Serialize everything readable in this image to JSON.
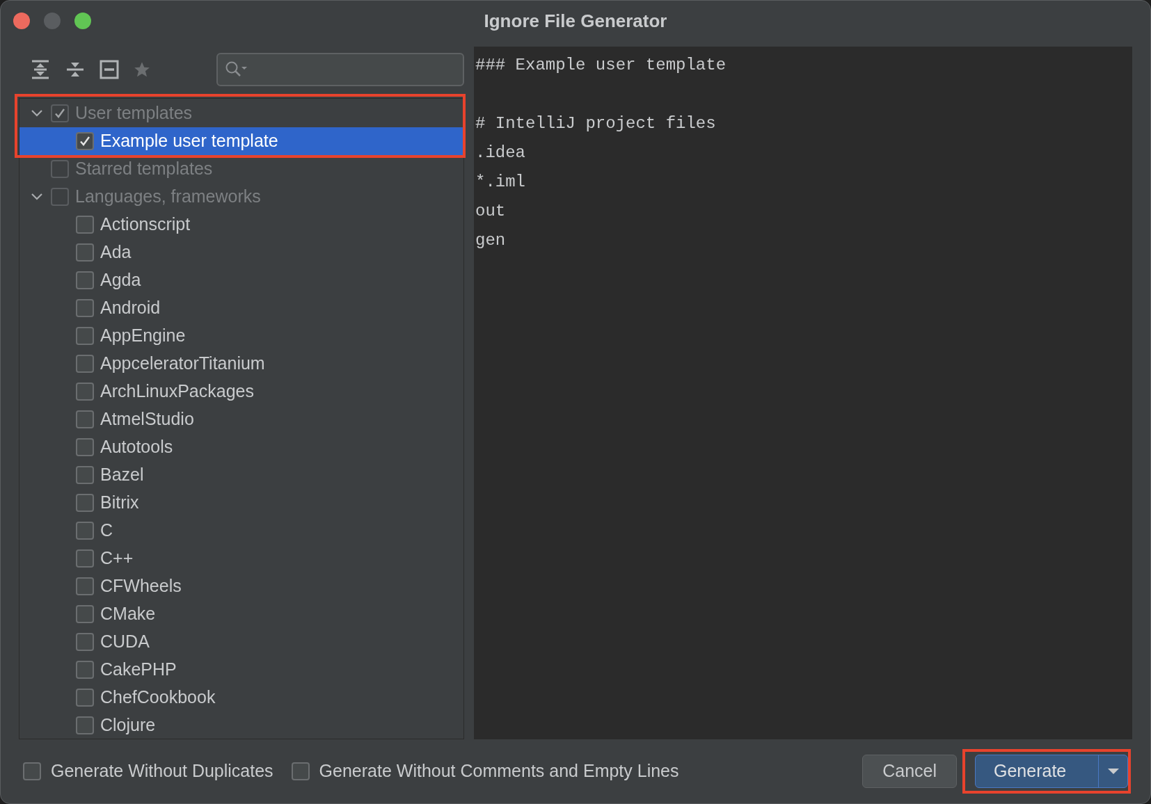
{
  "window": {
    "title": "Ignore File Generator"
  },
  "tree": [
    {
      "label": "User templates",
      "checked": true,
      "selected": false,
      "expanded": true,
      "children": [
        {
          "label": "Example user template",
          "checked": true,
          "selected": true,
          "highlighted": true
        }
      ]
    },
    {
      "label": "Starred templates",
      "checked": false,
      "selected": false
    },
    {
      "label": "Languages, frameworks",
      "checked": false,
      "selected": false,
      "expanded": true,
      "children": [
        {
          "label": "Actionscript",
          "checked": false,
          "selected": false
        },
        {
          "label": "Ada",
          "checked": false,
          "selected": false
        },
        {
          "label": "Agda",
          "checked": false,
          "selected": false
        },
        {
          "label": "Android",
          "checked": false,
          "selected": false
        },
        {
          "label": "AppEngine",
          "checked": false,
          "selected": false
        },
        {
          "label": "AppceleratorTitanium",
          "checked": false,
          "selected": false
        },
        {
          "label": "ArchLinuxPackages",
          "checked": false,
          "selected": false
        },
        {
          "label": "AtmelStudio",
          "checked": false,
          "selected": false
        },
        {
          "label": "Autotools",
          "checked": false,
          "selected": false
        },
        {
          "label": "Bazel",
          "checked": false,
          "selected": false
        },
        {
          "label": "Bitrix",
          "checked": false,
          "selected": false
        },
        {
          "label": "C",
          "checked": false,
          "selected": false
        },
        {
          "label": "C++",
          "checked": false,
          "selected": false
        },
        {
          "label": "CFWheels",
          "checked": false,
          "selected": false
        },
        {
          "label": "CMake",
          "checked": false,
          "selected": false
        },
        {
          "label": "CUDA",
          "checked": false,
          "selected": false
        },
        {
          "label": "CakePHP",
          "checked": false,
          "selected": false
        },
        {
          "label": "ChefCookbook",
          "checked": false,
          "selected": false
        },
        {
          "label": "Clojure",
          "checked": false,
          "selected": false
        }
      ]
    }
  ],
  "preview": {
    "blocks": [
      {
        "lines": [
          "### Example user template"
        ]
      },
      {
        "lines": [
          "# IntelliJ project files",
          ".idea",
          "*.iml",
          "out",
          "gen"
        ]
      }
    ]
  },
  "options": [
    {
      "label": "Generate Without Duplicates",
      "checked": false
    },
    {
      "label": "Generate Without Comments and Empty Lines",
      "checked": false
    }
  ],
  "buttons": {
    "cancel": "Cancel",
    "generate": {
      "label": "Generate",
      "highlighted": true
    }
  }
}
